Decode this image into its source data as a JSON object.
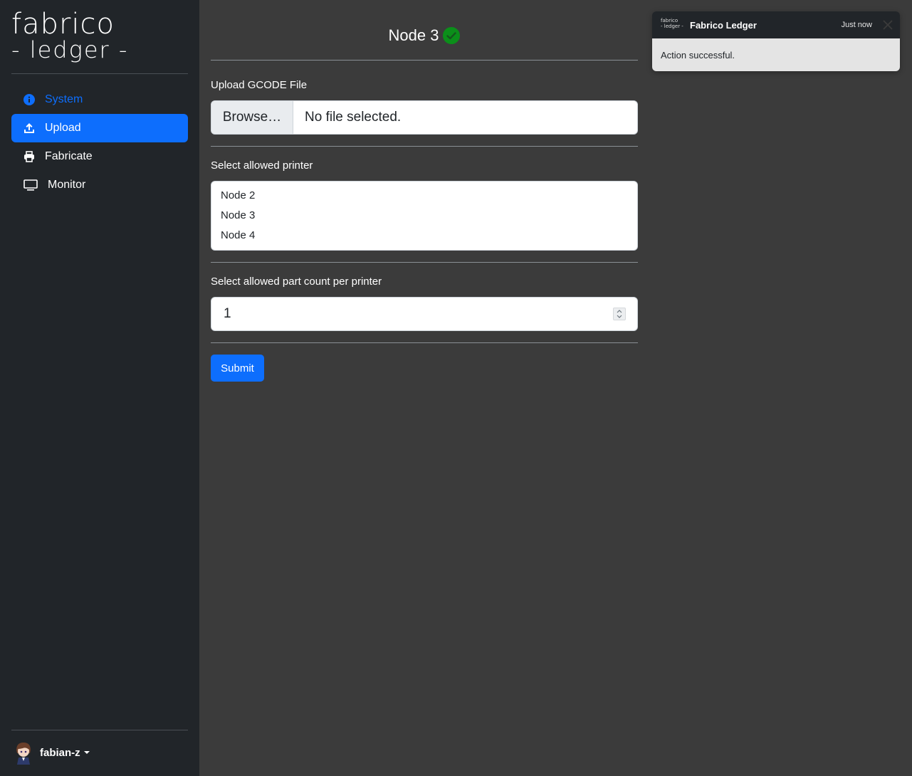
{
  "brand": {
    "logo_line1": "fabrico",
    "logo_line2": "- ledger -"
  },
  "sidebar": {
    "items": [
      {
        "label": "System",
        "icon": "info-circle-icon"
      },
      {
        "label": "Upload",
        "icon": "upload-icon"
      },
      {
        "label": "Fabricate",
        "icon": "printer-icon"
      },
      {
        "label": "Monitor",
        "icon": "monitor-icon"
      }
    ],
    "active": "Upload",
    "user": {
      "name": "fabian-z"
    }
  },
  "header": {
    "title": "Node 3",
    "status_icon": "check-circle-icon",
    "status_color": "#0b8f1a"
  },
  "form": {
    "upload_label": "Upload GCODE File",
    "browse_label": "Browse…",
    "file_placeholder": "No file selected.",
    "printer_label": "Select allowed printer",
    "printer_options": [
      "Node 2",
      "Node 3",
      "Node 4"
    ],
    "count_label": "Select allowed part count per printer",
    "count_value": "1",
    "submit_label": "Submit"
  },
  "toast": {
    "title": "Fabrico Ledger",
    "logo_line1": "fabrico",
    "logo_line2": "- ledger -",
    "time": "Just now",
    "message": "Action successful."
  },
  "colors": {
    "accent": "#0d6efd",
    "sidebar_bg": "#212529",
    "main_bg": "#3b3b3b",
    "success": "#0b8f1a"
  }
}
